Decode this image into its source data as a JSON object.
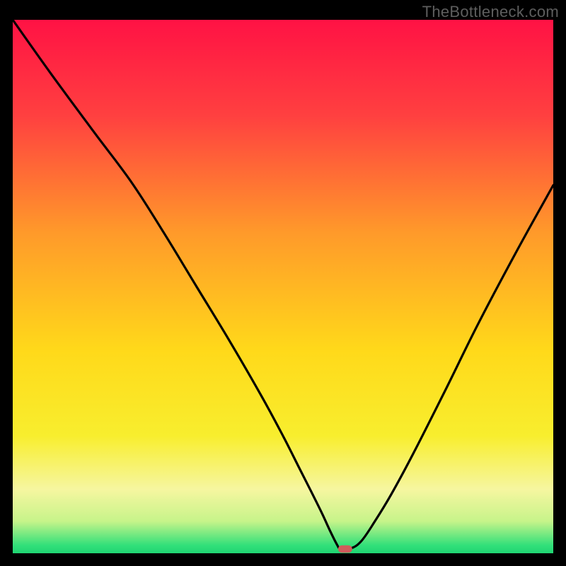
{
  "watermark": "TheBottleneck.com",
  "chart_data": {
    "type": "line",
    "title": "",
    "xlabel": "",
    "ylabel": "",
    "xlim": [
      0,
      100
    ],
    "ylim": [
      0,
      100
    ],
    "grid": false,
    "legend": false,
    "background": {
      "type": "gradient",
      "stops": [
        {
          "offset": 0.0,
          "color": "#ff1244"
        },
        {
          "offset": 0.18,
          "color": "#ff4040"
        },
        {
          "offset": 0.4,
          "color": "#ff9a2a"
        },
        {
          "offset": 0.62,
          "color": "#ffd91a"
        },
        {
          "offset": 0.78,
          "color": "#f8ee2e"
        },
        {
          "offset": 0.88,
          "color": "#f6f6a0"
        },
        {
          "offset": 0.94,
          "color": "#c7f48a"
        },
        {
          "offset": 0.985,
          "color": "#32e07a"
        },
        {
          "offset": 1.0,
          "color": "#1fd572"
        }
      ]
    },
    "curve": {
      "x": [
        0,
        7,
        15,
        22,
        28,
        34,
        40,
        46,
        50,
        53,
        55.5,
        57.3,
        58.8,
        60.0,
        60.6,
        62.5,
        64.5,
        67,
        70,
        74,
        80,
        86,
        93,
        100
      ],
      "y": [
        100,
        90,
        79,
        69.5,
        60,
        50,
        40,
        29.5,
        22,
        16,
        11,
        7.3,
        4.0,
        1.6,
        0.9,
        0.9,
        2.3,
        6.0,
        11.0,
        18.5,
        30.5,
        42.8,
        56.2,
        69.0
      ]
    },
    "marker": {
      "x": 61.5,
      "y": 0.8,
      "color": "#cf5b5b",
      "width": 2.6,
      "height": 1.4,
      "rx": 0.7
    }
  }
}
